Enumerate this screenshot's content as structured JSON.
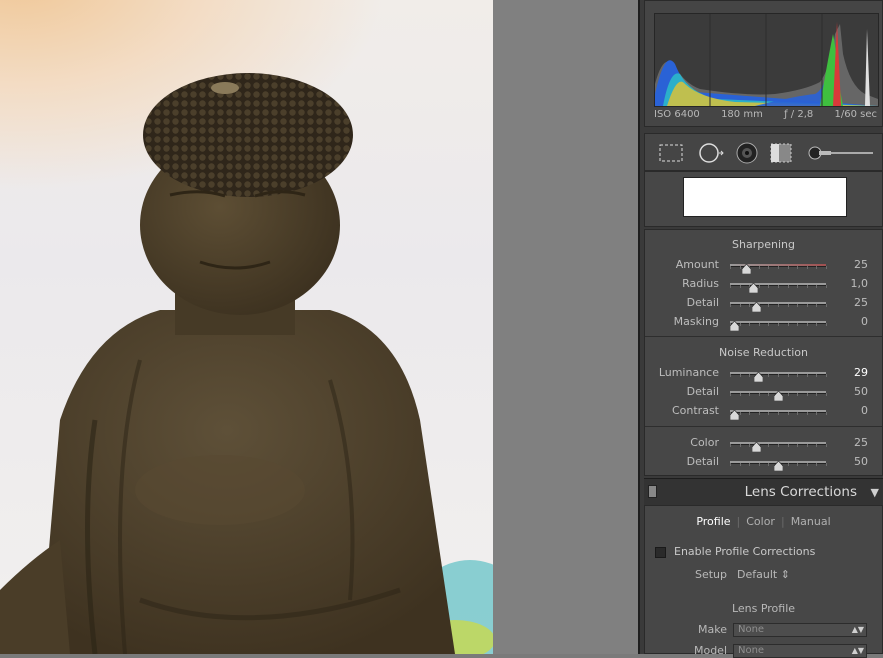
{
  "photo": {
    "subject": "buddha-statue"
  },
  "histogram": {
    "iso": "ISO 6400",
    "focal_length": "180 mm",
    "aperture": "ƒ / 2,8",
    "shutter": "1/60 sec",
    "clip_shadow_icon": "triangle-up-icon",
    "clip_highlight_icon": "triangle-up-icon"
  },
  "tools": [
    "crop-overlay-icon",
    "spot-removal-icon",
    "red-eye-icon",
    "graduated-filter-icon",
    "adjustment-brush-icon"
  ],
  "sharpening": {
    "title": "Sharpening",
    "amount": {
      "label": "Amount",
      "value": "25",
      "pos": 0.17
    },
    "radius": {
      "label": "Radius",
      "value": "1,0",
      "pos": 0.24
    },
    "detail": {
      "label": "Detail",
      "value": "25",
      "pos": 0.28
    },
    "masking": {
      "label": "Masking",
      "value": "0",
      "pos": 0.05
    }
  },
  "noise_reduction": {
    "title": "Noise Reduction",
    "luminance": {
      "label": "Luminance",
      "value": "29",
      "pos": 0.3
    },
    "detail": {
      "label": "Detail",
      "value": "50",
      "pos": 0.5
    },
    "contrast": {
      "label": "Contrast",
      "value": "0",
      "pos": 0.05
    },
    "color": {
      "label": "Color",
      "value": "25",
      "pos": 0.28
    },
    "color_detail": {
      "label": "Detail",
      "value": "50",
      "pos": 0.5
    }
  },
  "lens_corrections": {
    "title": "Lens Corrections",
    "tabs": [
      "Profile",
      "Color",
      "Manual"
    ],
    "enable_label": "Enable Profile Corrections",
    "setup_label": "Setup",
    "setup_value": "Default ⇕",
    "lens_profile_title": "Lens Profile",
    "make_label": "Make",
    "make_value": "None",
    "model_label": "Model",
    "model_value": "None"
  }
}
